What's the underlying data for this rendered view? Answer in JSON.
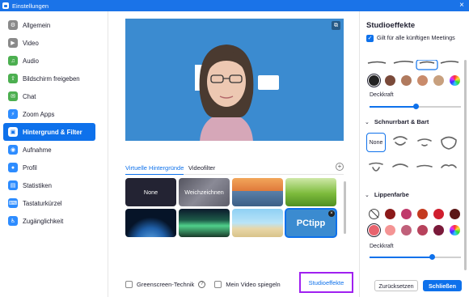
{
  "window": {
    "title": "Einstellungen",
    "close_glyph": "×"
  },
  "sidebar": {
    "items": [
      {
        "label": "Allgemein",
        "icon": "gear-icon",
        "color": "#8a8a8a",
        "glyph": "⚙"
      },
      {
        "label": "Video",
        "icon": "video-icon",
        "color": "#8a8a8a",
        "glyph": "▶"
      },
      {
        "label": "Audio",
        "icon": "headphones-icon",
        "color": "#4caf50",
        "glyph": "♫"
      },
      {
        "label": "Bildschirm freigeben",
        "icon": "share-screen-icon",
        "color": "#4caf50",
        "glyph": "⇧"
      },
      {
        "label": "Chat",
        "icon": "chat-icon",
        "color": "#4caf50",
        "glyph": "✉"
      },
      {
        "label": "Zoom Apps",
        "icon": "apps-icon",
        "color": "#2d8cff",
        "glyph": "⚡"
      },
      {
        "label": "Hintergrund & Filter",
        "icon": "background-icon",
        "color": "#ffffff",
        "glyph": "▣",
        "active": true
      },
      {
        "label": "Aufnahme",
        "icon": "record-icon",
        "color": "#2d8cff",
        "glyph": "◉"
      },
      {
        "label": "Profil",
        "icon": "profile-icon",
        "color": "#2d8cff",
        "glyph": "●"
      },
      {
        "label": "Statistiken",
        "icon": "statistics-icon",
        "color": "#2d8cff",
        "glyph": "▤"
      },
      {
        "label": "Tastaturkürzel",
        "icon": "keyboard-icon",
        "color": "#2d8cff",
        "glyph": "⌨"
      },
      {
        "label": "Zugänglichkeit",
        "icon": "accessibility-icon",
        "color": "#2d8cff",
        "glyph": "♿"
      }
    ]
  },
  "main": {
    "tabs": [
      {
        "label": "Virtuelle Hintergründe",
        "active": true
      },
      {
        "label": "Videofilter",
        "active": false
      }
    ],
    "add_glyph": "+",
    "backgrounds": [
      {
        "label": "None",
        "style": "solid",
        "color": "#232333",
        "selected": false
      },
      {
        "label": "Weichzeichnen",
        "style": "blur",
        "color": "#6a6a76",
        "selected": false
      },
      {
        "label": "",
        "style": "golden-gate",
        "selected": false
      },
      {
        "label": "",
        "style": "grass",
        "selected": false
      },
      {
        "label": "",
        "style": "earth",
        "selected": false
      },
      {
        "label": "",
        "style": "aurora",
        "selected": false
      },
      {
        "label": "",
        "style": "beach",
        "selected": false
      },
      {
        "label": "PCtipp",
        "style": "brand",
        "selected": true,
        "removable": true
      }
    ],
    "greenscreen_label": "Greenscreen-Technik",
    "mirror_label": "Mein Video spiegeln",
    "studio_button": "Studioeffekte",
    "help_glyph": "?"
  },
  "studio_panel": {
    "title": "Studioeffekte",
    "apply_label": "Gilt für alle künftigen Meetings",
    "apply_checked": true,
    "eyebrow_colors": [
      "#232323",
      "#7a4a3a",
      "#b07a5e",
      "#c98b6b",
      "#c8a07e",
      "rainbow"
    ],
    "eyebrow_selected": 0,
    "opacity_label": "Deckkraft",
    "eyebrow_opacity": 0.5,
    "beard_section": "Schnurrbart & Bart",
    "beard_none": "None",
    "lip_section": "Lippenfarbe",
    "lip_colors_row1": [
      "none",
      "#8b1a1a",
      "#c0396b",
      "#c43a1e",
      "#d01e2e",
      "#5b1616"
    ],
    "lip_colors_row2": [
      "#e8636e",
      "#f49494",
      "#c0607a",
      "#b7425c",
      "#7a1a3a",
      "rainbow"
    ],
    "lip_selected": 0,
    "lip_opacity": 0.68
  },
  "footer": {
    "reset": "Zurücksetzen",
    "close": "Schließen"
  },
  "colors": {
    "accent": "#0e71eb",
    "highlight": "#a020f0"
  }
}
